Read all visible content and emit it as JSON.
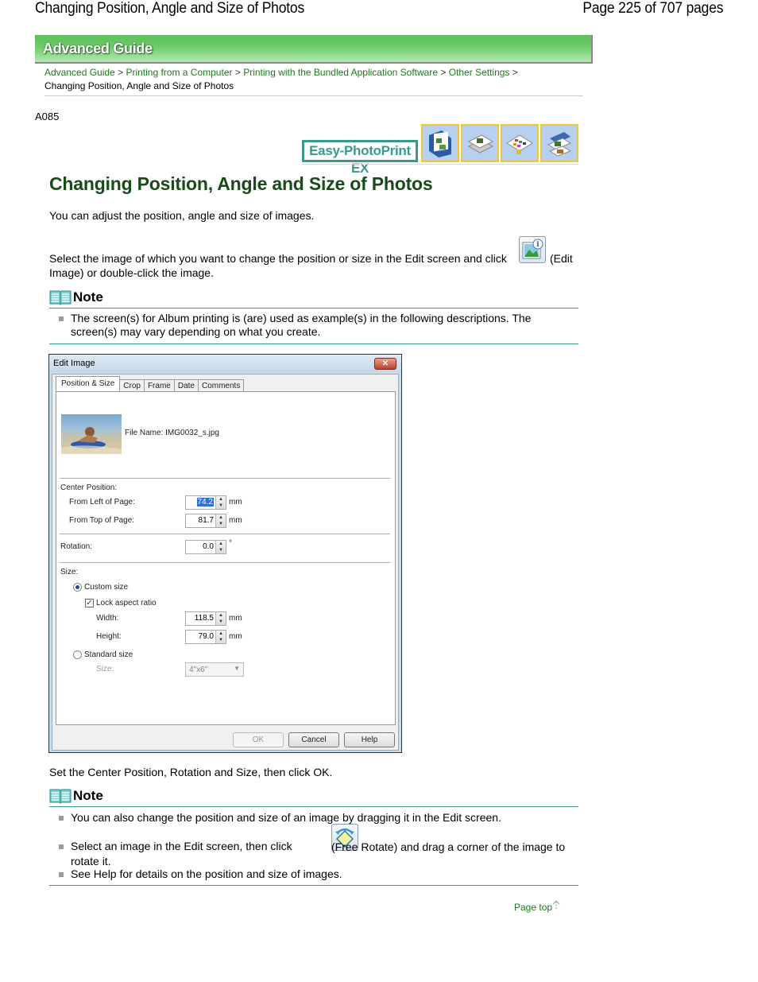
{
  "header": {
    "title": "Changing Position, Angle and Size of Photos",
    "page_indicator": "Page 225 of 707 pages"
  },
  "banner": {
    "label": "Advanced Guide"
  },
  "breadcrumb": {
    "items": [
      {
        "label": "Advanced Guide",
        "link": true
      },
      {
        "label": "Printing from a Computer",
        "link": true
      },
      {
        "label": "Printing with the Bundled Application Software",
        "link": true
      },
      {
        "label": "Other Settings",
        "link": true
      },
      {
        "label": "Changing Position, Angle and Size of Photos",
        "link": false
      }
    ],
    "separator": ">"
  },
  "doc_code": "A085",
  "product_logo": "Easy-PhotoPrint EX",
  "product_icons": [
    "album-icon",
    "stickers-icon",
    "layout-print-icon",
    "calendar-icon"
  ],
  "main": {
    "title": "Changing Position, Angle and Size of Photos",
    "intro": "You can adjust the position, angle and size of images.",
    "step1_before": "Select the image of which you want to change the position or size in the Edit screen and click",
    "step1_after": "(Edit Image) or double-click the image.",
    "note1": {
      "heading": "Note",
      "items": [
        "The screen(s) for Album printing is (are) used as example(s) in the following descriptions. The screen(s) may vary depending on what you create."
      ]
    },
    "step2": "Set the Center Position, Rotation and Size, then click OK.",
    "note2": {
      "heading": "Note",
      "items": [
        "You can also change the position and size of an image by dragging it in the Edit screen.",
        "Select an image in the Edit screen, then click",
        "(Free Rotate) and drag a corner of the image to rotate it.",
        "See Help for details on the position and size of images."
      ]
    },
    "page_top": "Page top"
  },
  "dialog": {
    "title": "Edit Image",
    "close": "✕",
    "tabs": [
      "Position & Size",
      "Crop",
      "Frame",
      "Date",
      "Comments"
    ],
    "active_tab": "Position & Size",
    "file_name_label": "File Name:",
    "file_name": "IMG0032_s.jpg",
    "center_position_label": "Center Position:",
    "from_left_label": "From Left of Page:",
    "from_left_value": "74.2",
    "from_top_label": "From Top of Page:",
    "from_top_value": "81.7",
    "rotation_label": "Rotation:",
    "rotation_value": "0.0",
    "rotation_unit": "°",
    "unit_mm": "mm",
    "size_label": "Size:",
    "custom_size_label": "Custom size",
    "custom_size_selected": true,
    "lock_aspect_label": "Lock aspect ratio",
    "lock_aspect_checked": true,
    "width_label": "Width:",
    "width_value": "118.5",
    "height_label": "Height:",
    "height_value": "79.0",
    "standard_size_label": "Standard size",
    "standard_size_selected": false,
    "size_combo_label": "Size:",
    "size_combo_value": "4\"x6\"",
    "ok": "OK",
    "cancel": "Cancel",
    "help": "Help"
  }
}
